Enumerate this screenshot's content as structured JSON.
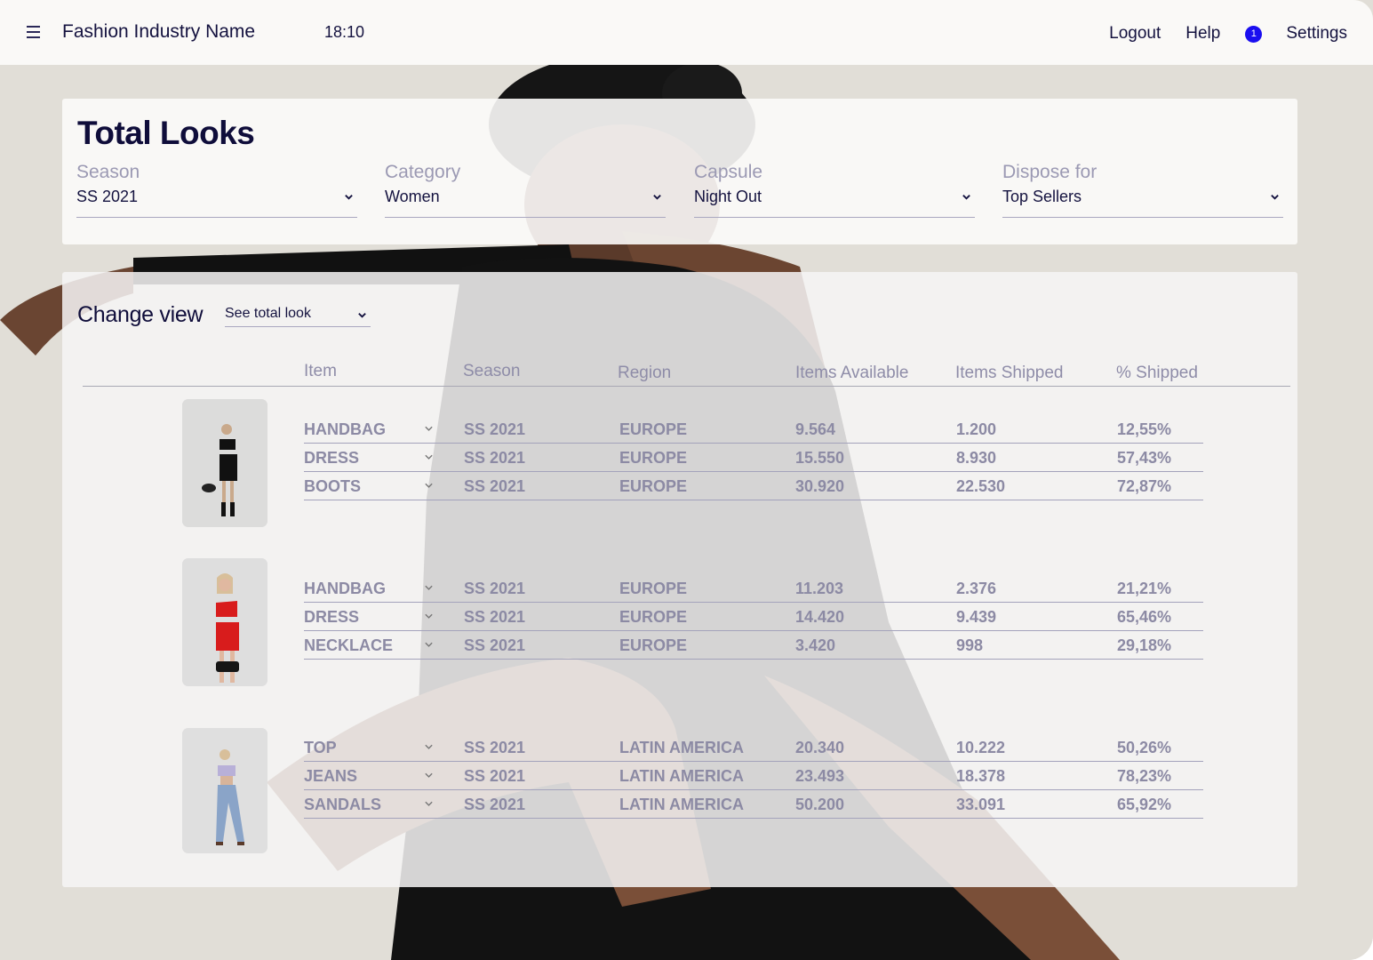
{
  "header": {
    "brand": "Fashion Industry Name",
    "time": "18:10",
    "menu_icon": "hamburger-menu-icon",
    "nav": {
      "logout": "Logout",
      "help": "Help",
      "notifications_count": "1",
      "settings": "Settings"
    },
    "badge_color": "#1a0ef0"
  },
  "filters": {
    "title": "Total Looks",
    "items": [
      {
        "label": "Season",
        "value": "SS 2021"
      },
      {
        "label": "Category",
        "value": "Women"
      },
      {
        "label": "Capsule",
        "value": "Night Out"
      },
      {
        "label": "Dispose for",
        "value": "Top Sellers"
      }
    ]
  },
  "view": {
    "label": "Change view",
    "selected": "See total look"
  },
  "table": {
    "columns": [
      "Item",
      "Season",
      "Region",
      "Items Available",
      "Items Shipped",
      "% Shipped"
    ],
    "looks": [
      {
        "thumbnail": "black-dress-look",
        "rows": [
          {
            "item": "HANDBAG",
            "season": "SS 2021",
            "region": "EUROPE",
            "available": "9.564",
            "shipped": "1.200",
            "pct": "12,55%"
          },
          {
            "item": "DRESS",
            "season": "SS 2021",
            "region": "EUROPE",
            "available": "15.550",
            "shipped": "8.930",
            "pct": "57,43%"
          },
          {
            "item": "BOOTS",
            "season": "SS 2021",
            "region": "EUROPE",
            "available": "30.920",
            "shipped": "22.530",
            "pct": "72,87%"
          }
        ]
      },
      {
        "thumbnail": "red-dress-look",
        "rows": [
          {
            "item": "HANDBAG",
            "season": "SS 2021",
            "region": "EUROPE",
            "available": "11.203",
            "shipped": "2.376",
            "pct": "21,21%"
          },
          {
            "item": "DRESS",
            "season": "SS 2021",
            "region": "EUROPE",
            "available": "14.420",
            "shipped": "9.439",
            "pct": "65,46%"
          },
          {
            "item": "NECKLACE",
            "season": "SS 2021",
            "region": "EUROPE",
            "available": "3.420",
            "shipped": "998",
            "pct": "29,18%"
          }
        ]
      },
      {
        "thumbnail": "jeans-top-look",
        "rows": [
          {
            "item": "TOP",
            "season": "SS 2021",
            "region": "LATIN AMERICA",
            "available": "20.340",
            "shipped": "10.222",
            "pct": "50,26%"
          },
          {
            "item": "JEANS",
            "season": "SS 2021",
            "region": "LATIN AMERICA",
            "available": "23.493",
            "shipped": "18.378",
            "pct": "78,23%"
          },
          {
            "item": "SANDALS",
            "season": "SS 2021",
            "region": "LATIN AMERICA",
            "available": "50.200",
            "shipped": "33.091",
            "pct": "65,92%"
          }
        ]
      }
    ]
  }
}
